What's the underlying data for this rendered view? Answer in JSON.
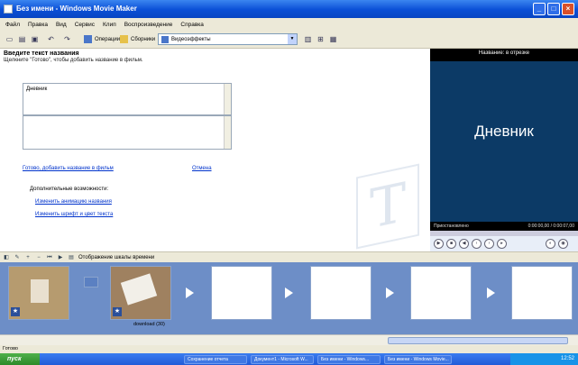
{
  "window": {
    "title": "Без имени - Windows Movie Maker"
  },
  "menu": [
    "Файл",
    "Правка",
    "Вид",
    "Сервис",
    "Клип",
    "Воспроизведение",
    "Справка"
  ],
  "toolbar": {
    "tasks_label": "Операции",
    "collections_label": "Сборники",
    "collection_combo": "Видеоэффекты"
  },
  "task_pane": {
    "title": "Введите текст названия",
    "hint": "Щелкните \"Готово\", чтобы добавить название в фильм.",
    "text_value": "Дневник",
    "done_link": "Готово, добавить название в фильм",
    "cancel_link": "Отмена",
    "more_options": "Дополнительные возможности:",
    "option_animation": "Изменить анимацию названия",
    "option_font": "Изменить шрифт и цвет текста"
  },
  "preview": {
    "title": "Название: в отрезке",
    "text": "Дневник",
    "status": "Приостановлено",
    "time": "0:00:00,00 / 0:00:07,00"
  },
  "storyboard_toolbar": {
    "show_timeline": "Отображение шкалы времени"
  },
  "clips": [
    {
      "label": ""
    },
    {
      "label": "download (30)"
    }
  ],
  "statusbar": {
    "text": "Готово"
  },
  "taskbar": {
    "start": "пуск",
    "items": [
      "Сохранение отчета",
      "Документ1 - Microsoft W...",
      "Без имени - Windows...",
      "Без имени - Windows Movie..."
    ],
    "clock": "12:52"
  }
}
